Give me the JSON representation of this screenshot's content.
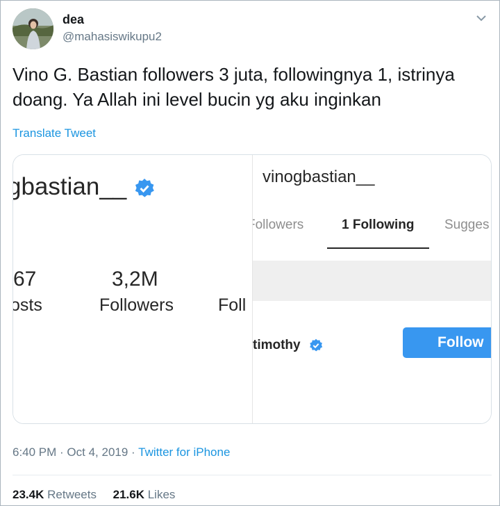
{
  "tweet": {
    "display_name": "dea",
    "handle": "@mahasiswikupu2",
    "text": "Vino G. Bastian followers 3 juta, followingnya 1, istrinya doang. Ya Allah ini level bucin yg aku inginkan",
    "translate_label": "Translate Tweet",
    "time": "6:40 PM",
    "date": "Oct 4, 2019",
    "source": "Twitter for iPhone",
    "retweets_count": "23.4K",
    "retweets_label": "Retweets",
    "likes_count": "21.6K",
    "likes_label": "Likes"
  },
  "media_left": {
    "username_partial": "gbastian__",
    "posts_count_partial": "67",
    "posts_label_partial": "osts",
    "followers_count": "3,2M",
    "followers_label": "Followers",
    "following_label_partial": "Foll"
  },
  "media_right": {
    "username": "vinogbastian__",
    "tab_followers": "Followers",
    "tab_following": "1 Following",
    "tab_suggested": "Sugges",
    "following_user": "timothy",
    "follow_button": "Follow"
  },
  "colors": {
    "link": "#1b95e0",
    "verified": "#3897f0",
    "follow_button": "#3897f0"
  },
  "icons": [
    "avatar-photo",
    "chevron-down-icon",
    "verified-badge-icon"
  ]
}
